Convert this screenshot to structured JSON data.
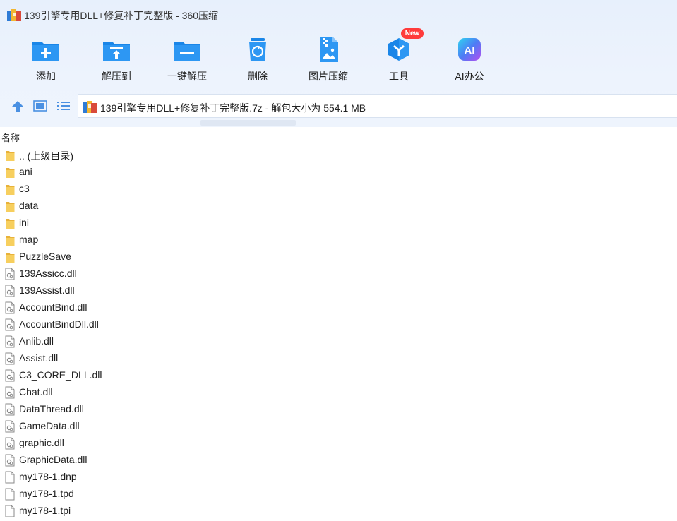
{
  "window": {
    "title": "139引擎专用DLL+修复补丁完整版 - 360压缩"
  },
  "toolbar": {
    "items": [
      {
        "label": "添加",
        "icon": "add-icon"
      },
      {
        "label": "解压到",
        "icon": "extract-to-icon"
      },
      {
        "label": "一键解压",
        "icon": "one-click-extract-icon"
      },
      {
        "label": "删除",
        "icon": "delete-icon"
      },
      {
        "label": "图片压缩",
        "icon": "image-compress-icon"
      },
      {
        "label": "工具",
        "icon": "tools-icon",
        "badge": "New"
      },
      {
        "label": "AI办公",
        "icon": "ai-office-icon",
        "icon_text": "AI"
      }
    ]
  },
  "navigation": {
    "address": "139引擎专用DLL+修复补丁完整版.7z - 解包大小为 554.1 MB"
  },
  "list": {
    "column_name": "名称",
    "items": [
      {
        "name": ".. (上级目录)",
        "type": "folder"
      },
      {
        "name": "ani",
        "type": "folder"
      },
      {
        "name": "c3",
        "type": "folder"
      },
      {
        "name": "data",
        "type": "folder"
      },
      {
        "name": "ini",
        "type": "folder"
      },
      {
        "name": "map",
        "type": "folder"
      },
      {
        "name": "PuzzleSave",
        "type": "folder"
      },
      {
        "name": "139Assicc.dll",
        "type": "dll"
      },
      {
        "name": "139Assist.dll",
        "type": "dll"
      },
      {
        "name": "AccountBind.dll",
        "type": "dll"
      },
      {
        "name": "AccountBindDll.dll",
        "type": "dll"
      },
      {
        "name": "Anlib.dll",
        "type": "dll"
      },
      {
        "name": "Assist.dll",
        "type": "dll"
      },
      {
        "name": "C3_CORE_DLL.dll",
        "type": "dll"
      },
      {
        "name": "Chat.dll",
        "type": "dll"
      },
      {
        "name": "DataThread.dll",
        "type": "dll"
      },
      {
        "name": "GameData.dll",
        "type": "dll"
      },
      {
        "name": "graphic.dll",
        "type": "dll"
      },
      {
        "name": "GraphicData.dll",
        "type": "dll"
      },
      {
        "name": "my178-1.dnp",
        "type": "file"
      },
      {
        "name": "my178-1.tpd",
        "type": "file"
      },
      {
        "name": "my178-1.tpi",
        "type": "file"
      }
    ]
  }
}
